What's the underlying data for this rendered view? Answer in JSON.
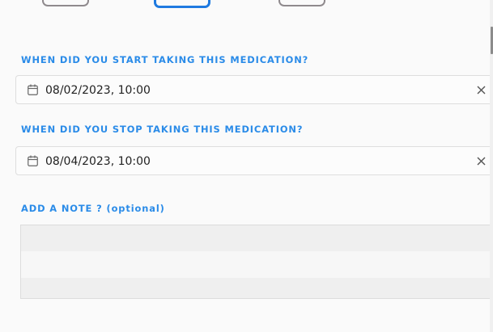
{
  "start_section": {
    "label": "WHEN DID YOU START TAKING THIS MEDICATION?",
    "value": "08/02/2023, 10:00"
  },
  "stop_section": {
    "label": "WHEN DID YOU STOP TAKING THIS MEDICATION?",
    "value": "08/04/2023, 10:00"
  },
  "note_section": {
    "label": "ADD A NOTE ? (optional)",
    "value": ""
  },
  "icons": {
    "date": "calendar-icon",
    "clear": "close-icon"
  },
  "colors": {
    "label": "#2a8be8",
    "active_tab": "#1f7ae0",
    "inactive_tab": "#8f8a8d"
  }
}
